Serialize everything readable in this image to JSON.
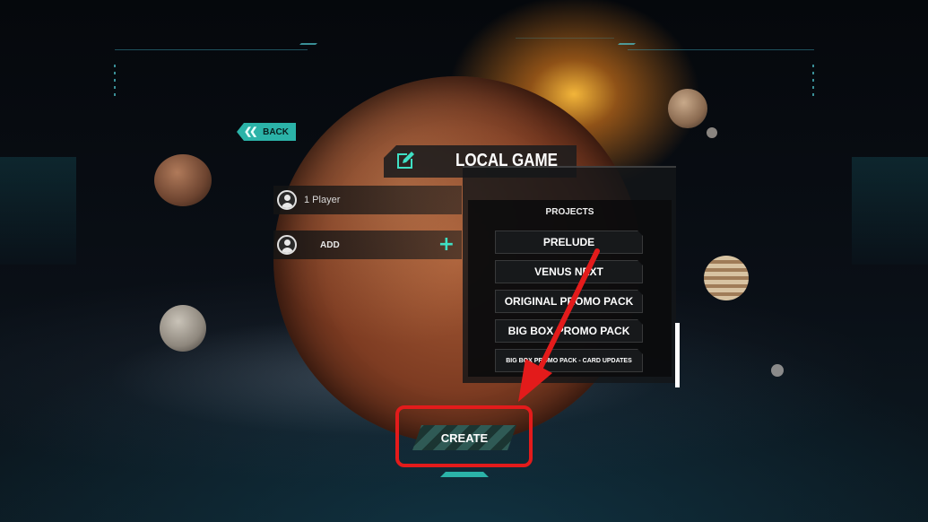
{
  "header": {
    "back_label": "BACK",
    "title": "LOCAL GAME"
  },
  "players": [
    {
      "label": "1 Player",
      "icon": "avatar-icon"
    },
    {
      "label": "ADD",
      "icon": "avatar-icon",
      "action_icon": "plus-icon"
    }
  ],
  "projects": {
    "header": "PROJECTS",
    "items": [
      "PRELUDE",
      "VENUS NEXT",
      "ORIGINAL PROMO PACK",
      "BIG BOX PROMO PACK",
      "BIG BOX PROMO PACK - CARD UPDATES"
    ]
  },
  "footer": {
    "create_label": "CREATE"
  },
  "colors": {
    "accent": "#2bb3a8",
    "plus": "#3fe0c4",
    "annotation": "#e31b1b"
  }
}
